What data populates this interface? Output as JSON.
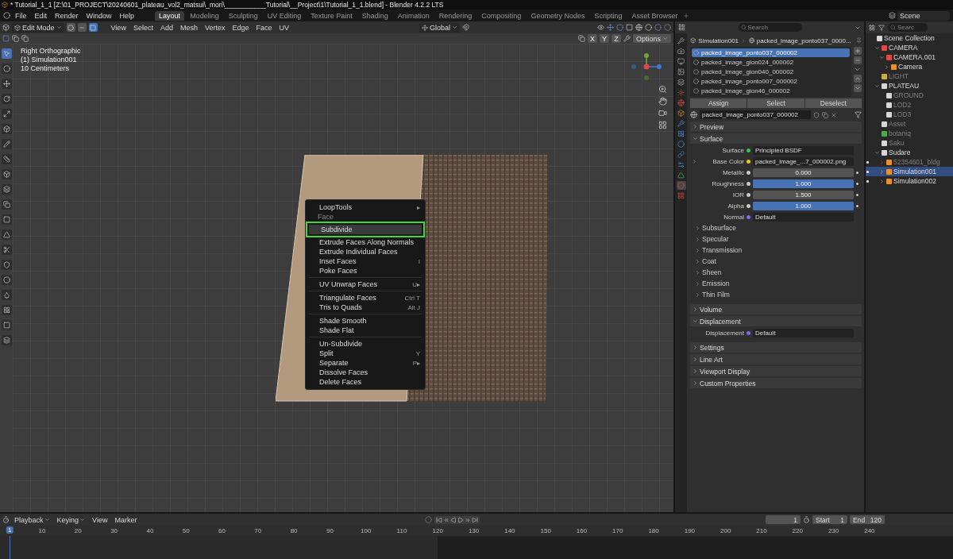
{
  "title_bar": {
    "title": "* Tutorial_1_1 [Z:\\01_PROJECT\\20240601_plateau_vol2_matsui\\_mori\\___________Tutorial\\__Project\\1\\Tutorial_1_1.blend] - Blender 4.2.2 LTS"
  },
  "menu_bar": [
    "File",
    "Edit",
    "Render",
    "Window",
    "Help"
  ],
  "workspaces": [
    {
      "label": "Layout",
      "selected": true
    },
    {
      "label": "Modeling",
      "selected": false
    },
    {
      "label": "Sculpting",
      "selected": false
    },
    {
      "label": "UV Editing",
      "selected": false
    },
    {
      "label": "Texture Paint",
      "selected": false
    },
    {
      "label": "Shading",
      "selected": false
    },
    {
      "label": "Animation",
      "selected": false
    },
    {
      "label": "Rendering",
      "selected": false
    },
    {
      "label": "Compositing",
      "selected": false
    },
    {
      "label": "Geometry Nodes",
      "selected": false
    },
    {
      "label": "Scripting",
      "selected": false
    },
    {
      "label": "Asset Browser",
      "selected": false
    }
  ],
  "scene": {
    "name": "Scene"
  },
  "viewport": {
    "mode": "Edit Mode",
    "select_modes": [
      {
        "kind": "vertex",
        "selected": false
      },
      {
        "kind": "edge",
        "selected": false
      },
      {
        "kind": "face",
        "selected": true
      }
    ],
    "menus": [
      "View",
      "Select",
      "Add",
      "Mesh",
      "Vertex",
      "Edge",
      "Face",
      "UV"
    ],
    "orientation": "Global",
    "axes": [
      "X",
      "Y",
      "Z"
    ],
    "options": "Options",
    "overlay_lines": [
      "Right Orthographic",
      "(1) Simulation001",
      "10 Centimeters"
    ],
    "tools": [
      {
        "selected": true
      },
      {
        "selected": false
      },
      {
        "selected": false
      },
      {
        "selected": false
      },
      {
        "selected": false
      },
      {
        "selected": false
      },
      {
        "selected": false
      },
      {
        "selected": false
      },
      {
        "selected": false
      },
      {
        "selected": false
      },
      {
        "selected": false
      },
      {
        "selected": false
      },
      {
        "selected": false
      },
      {
        "selected": false
      },
      {
        "selected": false
      },
      {
        "selected": false
      },
      {
        "selected": false
      },
      {
        "selected": false
      },
      {
        "selected": false
      },
      {
        "selected": false
      }
    ]
  },
  "context_menu": {
    "top_items": [
      {
        "label": "LoopTools",
        "shortcut": "▸",
        "highlighted": false
      }
    ],
    "title": "Face",
    "groups": [
      [
        {
          "label": "Subdivide",
          "highlighted": true
        },
        {
          "label": "Extrude Faces Along Normals",
          "highlighted": false
        },
        {
          "label": "Extrude Individual Faces",
          "highlighted": false
        },
        {
          "label": "Inset Faces",
          "shortcut": "I",
          "highlighted": false
        },
        {
          "label": "Poke Faces",
          "highlighted": false
        }
      ],
      [
        {
          "label": "UV Unwrap Faces",
          "shortcut": "U▸",
          "highlighted": false
        }
      ],
      [
        {
          "label": "Triangulate Faces",
          "shortcut": "Ctrl T",
          "highlighted": false
        },
        {
          "label": "Tris to Quads",
          "shortcut": "Alt J",
          "highlighted": false
        }
      ],
      [
        {
          "label": "Shade Smooth",
          "highlighted": false
        },
        {
          "label": "Shade Flat",
          "highlighted": false
        }
      ],
      [
        {
          "label": "Un-Subdivide",
          "highlighted": false
        },
        {
          "label": "Split",
          "shortcut": "Y",
          "highlighted": false
        },
        {
          "label": "Separate",
          "shortcut": "P▸",
          "highlighted": false
        },
        {
          "label": "Dissolve Faces",
          "highlighted": false
        },
        {
          "label": "Delete Faces",
          "highlighted": false
        }
      ]
    ]
  },
  "properties": {
    "search": {
      "placeholder": "Search"
    },
    "breadcrumb": [
      "Simulation001",
      "packed_image_ponto037_0000..."
    ],
    "tabs": [
      {
        "selected": false
      },
      {
        "selected": false
      },
      {
        "selected": false
      },
      {
        "selected": false
      },
      {
        "selected": false
      },
      {
        "selected": false
      },
      {
        "selected": false
      },
      {
        "selected": false
      },
      {
        "selected": false
      },
      {
        "selected": false
      },
      {
        "selected": false
      },
      {
        "selected": false
      },
      {
        "selected": false
      },
      {
        "selected": false
      },
      {
        "selected": true
      },
      {
        "selected": false
      }
    ],
    "material_slots": [
      {
        "label": "packed_image_ponto037_000002",
        "selected": true
      },
      {
        "label": "packed_image_gion024_000002",
        "selected": false
      },
      {
        "label": "packed_image_gion040_000002",
        "selected": false
      },
      {
        "label": "packed_image_ponto007_000002",
        "selected": false
      },
      {
        "label": "packed_image_gion46_000002",
        "selected": false
      }
    ],
    "slot_buttons": [
      "Assign",
      "Select",
      "Deselect"
    ],
    "material_name": "packed_image_ponto037_000002",
    "panels": [
      {
        "label": "Preview",
        "expanded": false
      },
      {
        "label": "Surface",
        "expanded": true,
        "fields": [
          {
            "label": "Surface",
            "kind": "link",
            "value": "Principled BSDF",
            "color": "#3fbf5f",
            "expandable": false,
            "animatable": false
          },
          {
            "label": "Base Color",
            "kind": "link",
            "value": "packed_image_...7_000002.png",
            "color": "#e6c619",
            "expandable": true,
            "animatable": false
          },
          {
            "label": "Metallic",
            "kind": "slider",
            "value": "0.000",
            "level": 0,
            "color": "#c8c8c8",
            "expandable": false,
            "animatable": true
          },
          {
            "label": "Roughness",
            "kind": "slider",
            "value": "1.000",
            "level": 1,
            "color": "#c8c8c8",
            "expandable": false,
            "animatable": true
          },
          {
            "label": "IOR",
            "kind": "number",
            "value": "1.500",
            "color": "#c8c8c8",
            "expandable": false,
            "animatable": true
          },
          {
            "label": "Alpha",
            "kind": "slider",
            "value": "1.000",
            "level": 1,
            "color": "#c8c8c8",
            "expandable": false,
            "animatable": true
          },
          {
            "label": "Normal",
            "kind": "link",
            "value": "Default",
            "color": "#7a6cf0",
            "expandable": false,
            "animatable": false
          }
        ],
        "subpanels": [
          {
            "label": "Subsurface",
            "expanded": false
          },
          {
            "label": "Specular",
            "expanded": false
          },
          {
            "label": "Transmission",
            "expanded": false
          },
          {
            "label": "Coat",
            "expanded": false
          },
          {
            "label": "Sheen",
            "expanded": false
          },
          {
            "label": "Emission",
            "expanded": false
          },
          {
            "label": "Thin Film",
            "expanded": false
          }
        ]
      },
      {
        "label": "Volume",
        "expanded": false
      },
      {
        "label": "Displacement",
        "expanded": true,
        "fields": [
          {
            "label": "Displacement",
            "kind": "link",
            "value": "Default",
            "color": "#7a6cf0",
            "expandable": false,
            "animatable": false
          }
        ]
      },
      {
        "label": "Settings",
        "expanded": false
      },
      {
        "label": "Line Art",
        "expanded": false
      },
      {
        "label": "Viewport Display",
        "expanded": false
      },
      {
        "label": "Custom Properties",
        "expanded": false
      }
    ]
  },
  "outliner": {
    "search": {
      "placeholder": "Searc"
    },
    "tree": [
      {
        "label": "Scene Collection",
        "kind": "collection",
        "color": "#d8d8d8",
        "dimmed": false,
        "selected": false,
        "children": [
          {
            "label": "CAMERA",
            "kind": "collection",
            "color": "#e04848",
            "expanded": true,
            "dimmed": false,
            "selected": false,
            "children": [
              {
                "label": "CAMERA.001",
                "kind": "collection",
                "color": "#e04848",
                "expanded": true,
                "dimmed": false,
                "selected": false,
                "children": [
                  {
                    "label": "Camera",
                    "kind": "camera",
                    "color": "#e8902c",
                    "expanded": false,
                    "dimmed": false,
                    "selected": false
                  }
                ]
              }
            ]
          },
          {
            "label": "LIGHT",
            "kind": "collection",
            "color": "#c8b040",
            "dimmed": true,
            "selected": false
          },
          {
            "label": "PLATEAU",
            "kind": "collection",
            "color": "#d8d8d8",
            "expanded": true,
            "dimmed": false,
            "selected": false,
            "children": [
              {
                "label": "GROUND",
                "kind": "collection",
                "color": "#d8d8d8",
                "dimmed": true,
                "selected": false
              },
              {
                "label": "LOD2",
                "kind": "collection",
                "color": "#d8d8d8",
                "dimmed": true,
                "selected": false
              },
              {
                "label": "LOD3",
                "kind": "collection",
                "color": "#d8d8d8",
                "dimmed": true,
                "selected": false
              }
            ]
          },
          {
            "label": "Asset",
            "kind": "collection",
            "color": "#d8d8d8",
            "dimmed": true,
            "selected": false
          },
          {
            "label": "botaniq",
            "kind": "collection",
            "color": "#4caa4c",
            "dimmed": true,
            "selected": false
          },
          {
            "label": "Saku",
            "kind": "collection",
            "color": "#d8d8d8",
            "dimmed": true,
            "selected": false
          },
          {
            "label": "Sudare",
            "kind": "collection",
            "color": "#d8d8d8",
            "expanded": true,
            "dimmed": false,
            "selected": false,
            "children": [
              {
                "label": "52354601_bldg",
                "kind": "mesh",
                "color": "#e8902c",
                "expanded": false,
                "dimmed": true,
                "selected": false
              },
              {
                "label": "Simulation001",
                "kind": "mesh",
                "color": "#e8902c",
                "expanded": false,
                "dimmed": false,
                "selected": true
              },
              {
                "label": "Simulation002",
                "kind": "mesh",
                "color": "#e8902c",
                "expanded": false,
                "dimmed": false,
                "selected": false
              }
            ]
          }
        ]
      }
    ]
  },
  "timeline": {
    "menus": [
      {
        "label": "Playback",
        "dropdown": true
      },
      {
        "label": "Keying",
        "dropdown": true
      },
      {
        "label": "View",
        "dropdown": false
      },
      {
        "label": "Marker",
        "dropdown": false
      }
    ],
    "current_frame": "1",
    "start_label": "Start",
    "start": "1",
    "end_label": "End",
    "end": "120",
    "playhead": "1",
    "ruler": [
      "10",
      "20",
      "30",
      "40",
      "50",
      "60",
      "70",
      "80",
      "90",
      "100",
      "110",
      "120",
      "130",
      "140",
      "150",
      "160",
      "170",
      "180",
      "190",
      "200",
      "210",
      "220",
      "230",
      "240"
    ]
  }
}
